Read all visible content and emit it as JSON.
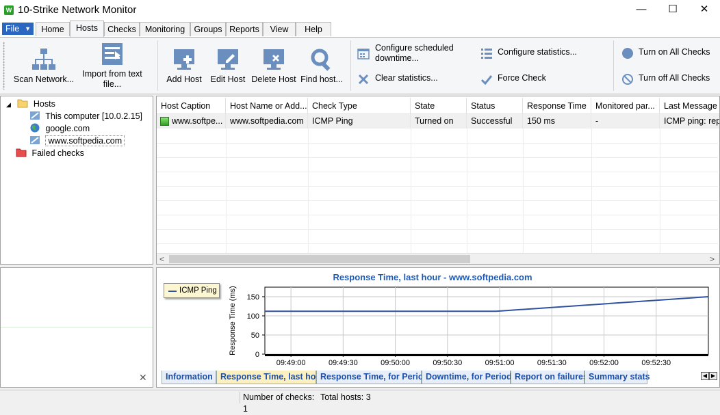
{
  "window": {
    "title": "10-Strike Network Monitor",
    "logo_text": "W"
  },
  "window_controls": {
    "minimize": "—",
    "maximize": "☐",
    "close": "✕"
  },
  "menu": {
    "file": "File",
    "tabs": [
      "Home",
      "Hosts",
      "Checks",
      "Monitoring",
      "Groups",
      "Reports",
      "View",
      "Help"
    ],
    "active": "Hosts"
  },
  "ribbon": {
    "scan_network": "Scan Network...",
    "import_text": "Import from text file...",
    "add_host": "Add Host",
    "edit_host": "Edit Host",
    "delete_host": "Delete Host",
    "find_host": "Find host...",
    "configure_downtime": "Configure scheduled downtime...",
    "clear_statistics": "Clear statistics...",
    "configure_statistics": "Configure statistics...",
    "force_check": "Force Check",
    "turn_on_all": "Turn on All Checks",
    "turn_off_all": "Turn off All Checks"
  },
  "tree": {
    "root": "Hosts",
    "children": [
      "This computer [10.0.2.15]",
      "google.com",
      "www.softpedia.com"
    ],
    "failed": "Failed checks"
  },
  "grid": {
    "columns": [
      "Host Caption",
      "Host Name or Add...",
      "Check Type",
      "State",
      "Status",
      "Response Time",
      "Monitored par...",
      "Last Message"
    ],
    "rows": [
      [
        "www.softpe...",
        "www.softpedia.com",
        "ICMP Ping",
        "Turned on",
        "Successful",
        "150 ms",
        "-",
        "ICMP ping: repl"
      ]
    ]
  },
  "scroll": {
    "left": "<",
    "right": ">"
  },
  "lower_left": {
    "close": "✕"
  },
  "chart_data": {
    "type": "line",
    "title": "Response Time, last hour - www.softpedia.com",
    "ylabel": "Response Time (ms)",
    "xlabel": "",
    "x_ticks": [
      "09:49:00",
      "09:49:30",
      "09:50:00",
      "09:50:30",
      "09:51:00",
      "09:51:30",
      "09:52:00",
      "09:52:30"
    ],
    "y_ticks": [
      0,
      50,
      100,
      150
    ],
    "ylim": [
      0,
      175
    ],
    "series": [
      {
        "name": "ICMP Ping",
        "color": "#3050a0",
        "x": [
          "09:48:45",
          "09:50:58",
          "09:53:00"
        ],
        "values": [
          112,
          112,
          150
        ]
      }
    ],
    "legend": "top-left",
    "grid": true
  },
  "bottom_tabs": [
    "Information",
    "Response Time, last hour",
    "Response Time, for Period",
    "Downtime, for Period",
    "Report on failures",
    "Summary stats"
  ],
  "bottom_tabs_active": "Response Time, last hour",
  "status": {
    "checks": "Number of checks: 1",
    "hosts": "Total hosts: 3"
  }
}
